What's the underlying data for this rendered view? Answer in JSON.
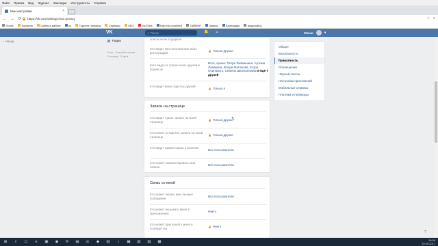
{
  "menubar": [
    "Файл",
    "Правка",
    "Вид",
    "Журнал",
    "Закладки",
    "Инструменты",
    "Справка"
  ],
  "tab": {
    "title": "Мои настройки",
    "close": "×"
  },
  "address": {
    "url": "https://vk.com/settings?act=privacy",
    "back": "←",
    "forward": "→",
    "reload": "⟳",
    "star": "☆",
    "menu": "≡"
  },
  "bookmarks": [
    "Почта",
    "Торговля",
    "Сайты в работе",
    "vk",
    "Торрент-трекеры",
    "Сервисы",
    "SEO",
    "YouTube",
    "http://vk.com/feed",
    "ТАЙМЕР",
    "Записи",
    "Календарь",
    "выручкаКЦ"
  ],
  "vk": {
    "logo": "VK",
    "search_placeholder": "Поиск",
    "search_icon": "⌕",
    "bell": "🔔",
    "music": "♫",
    "user": "Stanar"
  },
  "leftmenu": {
    "item": "Назад",
    "icon": "‹"
  },
  "navmenu": {
    "item": "Радио"
  },
  "footer_links": [
    "Блог",
    "Разработчикам",
    "Реклама",
    "Ещё ▾"
  ],
  "sections": {
    "first": {
      "rows": [
        {
          "label": "список моих подарков",
          "value": ""
        },
        {
          "label": "Кто видит местоположение моих фотографий",
          "value": "Только друзья",
          "lock": true
        },
        {
          "label": "Кого видно в списке моих друзей и подписок",
          "value": "Всех, кроме: Петра Яковишина, Артема Ломакина, Влада Матюкова, Егора Осипового, Семена Школьникова",
          "bold": "и ещё 7 друзей"
        },
        {
          "label": "Кто видит моих скрытых друзей",
          "value": "Только я",
          "lock": true
        }
      ]
    },
    "wall": {
      "title": "Записи на странице",
      "rows": [
        {
          "label": "Кто видит чужие записи на моей странице",
          "value": "Только друзья",
          "lock": true
        },
        {
          "label": "Кто может оставлять записи на моей странице",
          "value": "Только друзья",
          "lock": true
        },
        {
          "label": "Кто видит комментарии к записям",
          "value": "Все пользователи"
        },
        {
          "label": "Кто может комментировать мои записи",
          "value": "Все пользователи"
        }
      ]
    },
    "contact": {
      "title": "Связь со мной",
      "rows": [
        {
          "label": "Кто может писать мне личные сообщения",
          "value": "Все пользователи"
        },
        {
          "label": "Кто может вызывать меня в приложениях",
          "value": "Никто"
        },
        {
          "label": "Кто может приглашать меня в сообщества",
          "value": "Никто",
          "lock": true
        }
      ]
    }
  },
  "rightnav": [
    {
      "label": "Общее",
      "active": false
    },
    {
      "label": "Безопасность",
      "active": false
    },
    {
      "label": "Приватность",
      "active": true
    },
    {
      "label": "Оповещения",
      "active": false
    },
    {
      "label": "Чёрный список",
      "active": false
    },
    {
      "label": "Настройки приложений",
      "active": false
    },
    {
      "label": "Мобильные сервисы",
      "active": false
    },
    {
      "label": "Платежи и переводы",
      "active": false
    }
  ],
  "taskbar": {
    "icons": [
      "⊞",
      "⌕",
      "▭",
      "e",
      "▣",
      "◉",
      "✉",
      "▤",
      "◎",
      "◆",
      "▥",
      "♪",
      "▦",
      "▧",
      "▨",
      "▩"
    ],
    "time": "16:06",
    "date": "19.05.2017"
  },
  "help": "?"
}
